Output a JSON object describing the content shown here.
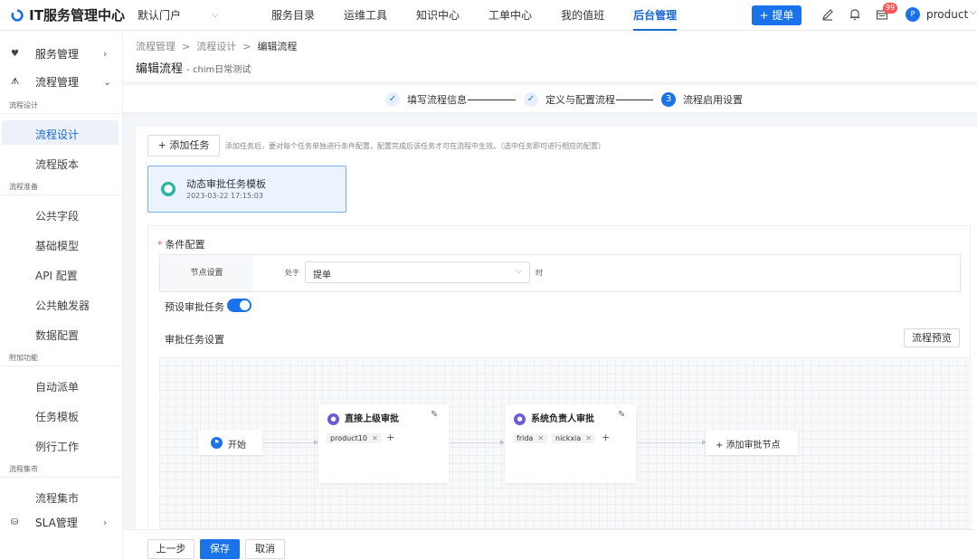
{
  "header": {
    "app_title": "IT服务管理中心",
    "portal": "默认门户",
    "nav": [
      "服务目录",
      "运维工具",
      "知识中心",
      "工单中心",
      "我的值班",
      "后台管理"
    ],
    "nav_active": "后台管理",
    "ticket_button": "+ 提单",
    "badge_count": "99",
    "username": "product",
    "accent": "#1a73e8"
  },
  "sidebar": {
    "service_mgmt": "服务管理",
    "process_mgmt": "流程管理",
    "group_design": "流程设计",
    "item_design": "流程设计",
    "item_version": "流程版本",
    "group_prepare": "流程准备",
    "item_public_fields": "公共字段",
    "item_base_model": "基础模型",
    "item_api": "API 配置",
    "item_trigger": "公共触发器",
    "item_data": "数据配置",
    "group_addon": "附加功能",
    "item_dispatch": "自动派单",
    "item_template": "任务模板",
    "item_routine": "例行工作",
    "group_market": "流程集市",
    "item_market": "流程集市",
    "sla_mgmt": "SLA管理"
  },
  "breadcrumb": {
    "b1": "流程管理",
    "b2": "流程设计",
    "b3": "编辑流程",
    "sep": ">"
  },
  "page": {
    "title": "编辑流程",
    "subtitle": "- chim日常测试"
  },
  "steps": [
    {
      "label": "填写流程信息",
      "state": "done"
    },
    {
      "label": "定义与配置流程",
      "state": "done"
    },
    {
      "label": "流程启用设置",
      "state": "current",
      "num": "3"
    }
  ],
  "task": {
    "add_button": "+ 添加任务",
    "hint": "添加任务后，要对每个任务单独进行条件配置，配置完成后该任务才可在流程中生效。（选中任务即可进行相应的配置）",
    "card_name": "动态审批任务模板",
    "card_date": "2023-03-22 17:15:03"
  },
  "condition": {
    "title": "条件配置",
    "node_label": "节点设置",
    "at": "处于",
    "select_value": "提单",
    "when": "时",
    "preset_label": "预设审批任务",
    "preset_on": true,
    "approval_settings": "审批任务设置",
    "preview_button": "流程预览"
  },
  "flow": {
    "start": "开始",
    "node1_title": "直接上级审批",
    "node1_people": [
      "product10"
    ],
    "node2_title": "系统负责人审批",
    "node2_people": [
      "frida",
      "nickxia"
    ],
    "add_node": "+ 添加审批节点"
  },
  "footer": {
    "prev": "上一步",
    "save": "保存",
    "cancel": "取消"
  }
}
